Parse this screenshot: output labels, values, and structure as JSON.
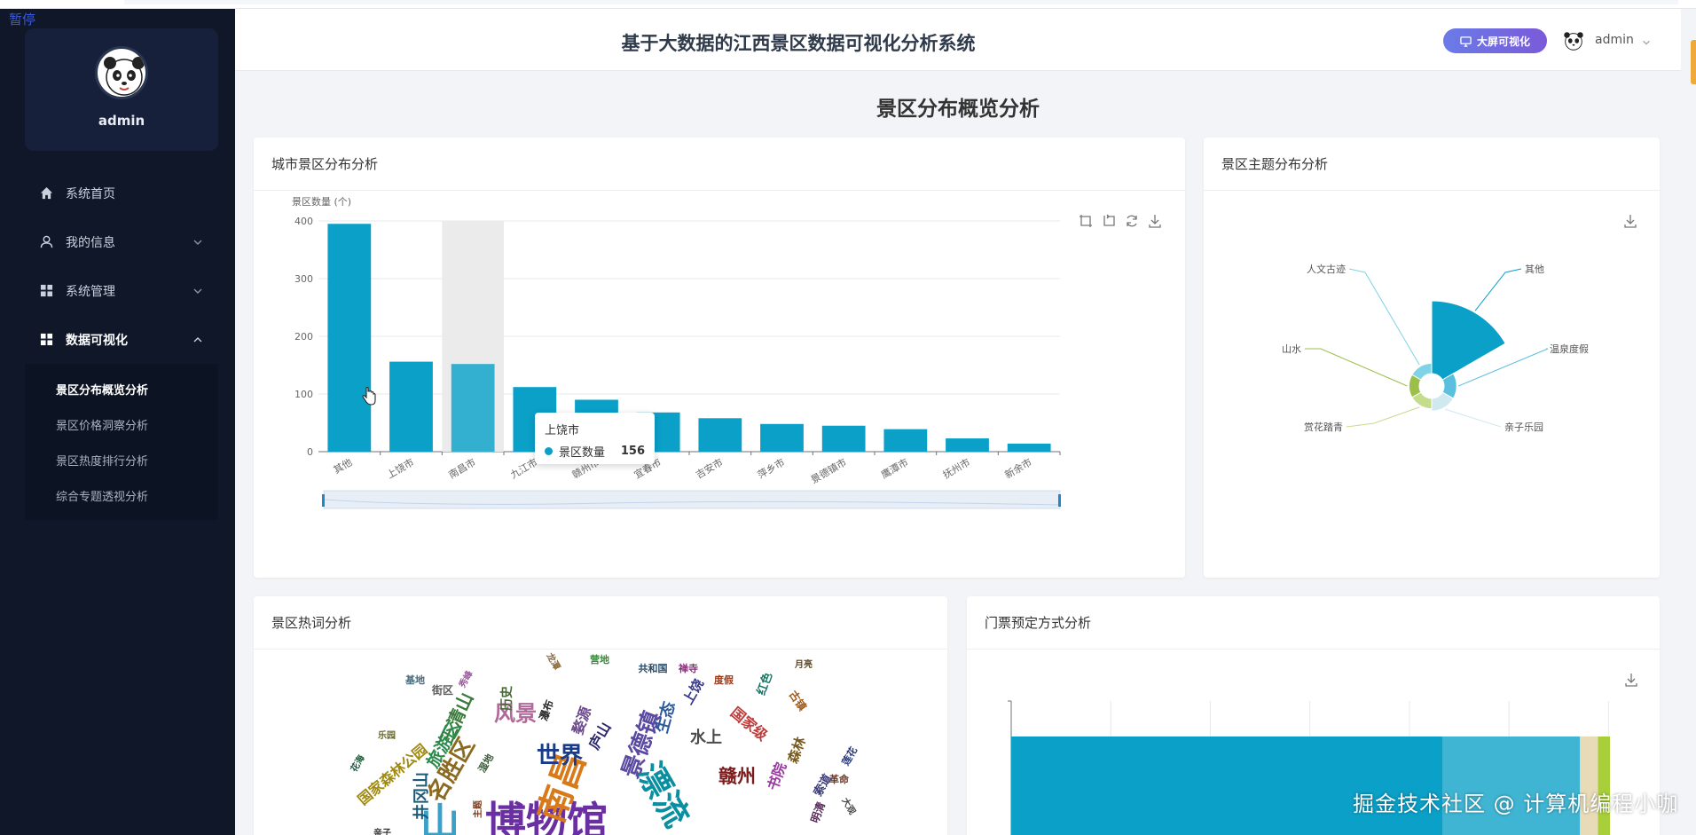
{
  "overlay": {
    "pause_label": "暂停",
    "watermark": "掘金技术社区 @ 计算机编程小咖"
  },
  "sidebar": {
    "username": "admin",
    "menu": [
      {
        "label": "系统首页",
        "icon": "home-icon"
      },
      {
        "label": "我的信息",
        "icon": "user-icon"
      },
      {
        "label": "系统管理",
        "icon": "grid-icon"
      },
      {
        "label": "数据可视化",
        "icon": "grid-icon"
      }
    ],
    "submenu": [
      "景区分布概览分析",
      "景区价格洞察分析",
      "景区热度排行分析",
      "综合专题透视分析"
    ]
  },
  "header": {
    "title": "基于大数据的江西景区数据可视化分析系统",
    "big_screen_label": "大屏可视化",
    "username": "admin"
  },
  "page": {
    "title": "景区分布概览分析"
  },
  "cards": {
    "city": "城市景区分布分析",
    "theme": "景区主题分布分析",
    "hotword": "景区热词分析",
    "ticket": "门票预定方式分析"
  },
  "tooltip": {
    "city": "上饶市",
    "series": "景区数量",
    "value": "156"
  },
  "colors": {
    "primary": "#0aa0c8",
    "sidebar_bg": "#0f1729",
    "accent_button": "#6a7be8"
  },
  "chart_data": [
    {
      "type": "bar",
      "title": "城市景区分布分析",
      "ylabel": "景区数量 (个)",
      "ylim": [
        0,
        400
      ],
      "yticks": [
        0,
        100,
        200,
        300,
        400
      ],
      "categories": [
        "其他",
        "上饶市",
        "南昌市",
        "九江市",
        "赣州市",
        "宜春市",
        "吉安市",
        "萍乡市",
        "景德镇市",
        "鹰潭市",
        "抚州市",
        "新余市"
      ],
      "values": [
        395,
        156,
        152,
        112,
        90,
        68,
        58,
        48,
        45,
        39,
        23,
        14
      ]
    },
    {
      "type": "pie",
      "title": "景区主题分布分析",
      "rose": true,
      "categories": [
        "其他",
        "温泉度假",
        "亲子乐园",
        "赏花踏青",
        "山水",
        "人文古迹"
      ],
      "values": [
        100,
        3,
        3,
        2,
        2,
        2
      ],
      "colors": [
        "#0aa0c8",
        "#5bc0de",
        "#d0e8f0",
        "#c5dc8a",
        "#9bbf4a",
        "#7fd3e6"
      ]
    },
    {
      "type": "bar",
      "title": "门票预定方式分析",
      "orientation": "horizontal",
      "stacked": true,
      "values": [
        0.72,
        0.23,
        0.03,
        0.02
      ],
      "colors": [
        "#0aa0c8",
        "#3fb5d3",
        "#e8dcb8",
        "#a8cf3a"
      ]
    }
  ],
  "wordcloud": [
    {
      "t": "博物馆",
      "s": 46,
      "c": "#6a2fa0"
    },
    {
      "t": "南昌",
      "s": 40,
      "c": "#d97a1a"
    },
    {
      "t": "漂流",
      "s": 38,
      "c": "#0a8fa0"
    },
    {
      "t": "山",
      "s": 44,
      "c": "#3aa0c8"
    },
    {
      "t": "景德镇",
      "s": 26,
      "c": "#5a4aa0"
    },
    {
      "t": "名胜区",
      "s": 26,
      "c": "#8a6a20"
    },
    {
      "t": "世界",
      "s": 26,
      "c": "#1a3a8a"
    },
    {
      "t": "风景",
      "s": 24,
      "c": "#b06a9a"
    },
    {
      "t": "赣州",
      "s": 21,
      "c": "#7a1a1a"
    },
    {
      "t": "三清山",
      "s": 20,
      "c": "#3a7a3a"
    },
    {
      "t": "旅游区",
      "s": 19,
      "c": "#2a8a4a"
    },
    {
      "t": "国家森林公园",
      "s": 16,
      "c": "#a08a10"
    },
    {
      "t": "水上",
      "s": 18,
      "c": "#4a4a4a"
    },
    {
      "t": "生态",
      "s": 18,
      "c": "#2a5a9a"
    },
    {
      "t": "国家级",
      "s": 16,
      "c": "#c03a3a"
    },
    {
      "t": "书院",
      "s": 16,
      "c": "#9a3aa0"
    },
    {
      "t": "森林",
      "s": 15,
      "c": "#7a5a1a"
    },
    {
      "t": "井冈山",
      "s": 18,
      "c": "#1a5a7a"
    },
    {
      "t": "婺源",
      "s": 16,
      "c": "#6a4a8a"
    },
    {
      "t": "上饶",
      "s": 15,
      "c": "#3a3a8a"
    },
    {
      "t": "历史",
      "s": 14,
      "c": "#4a6a3a"
    },
    {
      "t": "庐山",
      "s": 16,
      "c": "#2a2a6a"
    },
    {
      "t": "街区",
      "s": 12,
      "c": "#5a5a5a"
    },
    {
      "t": "基地",
      "s": 11,
      "c": "#4a6a7a"
    },
    {
      "t": "营地",
      "s": 11,
      "c": "#3a8a3a"
    },
    {
      "t": "共和国",
      "s": 11,
      "c": "#2a4a6a"
    },
    {
      "t": "禅寺",
      "s": 11,
      "c": "#8a2a7a"
    },
    {
      "t": "度假",
      "s": 11,
      "c": "#9a3a1a"
    },
    {
      "t": "红色",
      "s": 13,
      "c": "#1a7a6a"
    },
    {
      "t": "古镇",
      "s": 12,
      "c": "#a05a1a"
    },
    {
      "t": "索道",
      "s": 13,
      "c": "#3a3a7a"
    },
    {
      "t": "明清",
      "s": 12,
      "c": "#5a2a5a"
    },
    {
      "t": "革命",
      "s": 11,
      "c": "#6a3a2a"
    },
    {
      "t": "大观",
      "s": 10,
      "c": "#4a4a4a"
    },
    {
      "t": "瀑布",
      "s": 12,
      "c": "#2a2a2a"
    },
    {
      "t": "主题",
      "s": 10,
      "c": "#7a3a1a"
    },
    {
      "t": "亲子",
      "s": 10,
      "c": "#3a3a3a"
    },
    {
      "t": "龙潭",
      "s": 10,
      "c": "#8a6a3a"
    },
    {
      "t": "莲花",
      "s": 11,
      "c": "#2a3a7a"
    },
    {
      "t": "月亮",
      "s": 10,
      "c": "#5a4a2a"
    },
    {
      "t": "秀峰",
      "s": 10,
      "c": "#9a5a9a"
    },
    {
      "t": "湿地",
      "s": 11,
      "c": "#3a5a3a"
    },
    {
      "t": "乐园",
      "s": 10,
      "c": "#6a6a2a"
    },
    {
      "t": "花海",
      "s": 10,
      "c": "#1a5a3a"
    }
  ]
}
